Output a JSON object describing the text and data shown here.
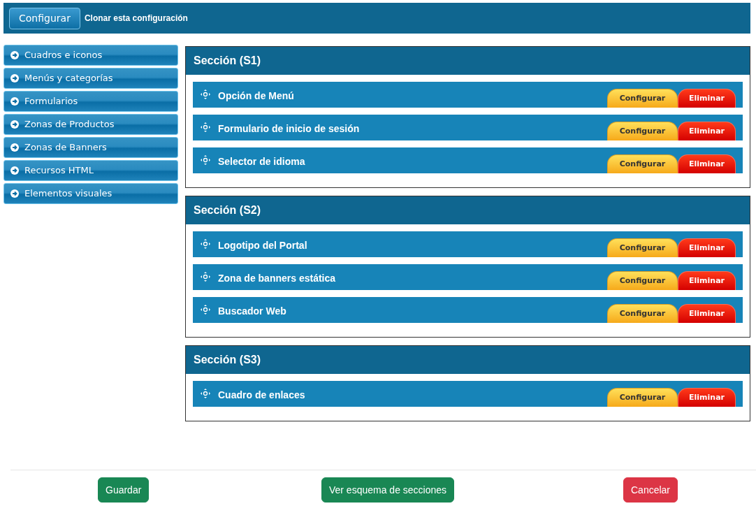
{
  "toolbar": {
    "button": "Configurar",
    "link": "Clonar esta configuración"
  },
  "sidebar": {
    "items": [
      {
        "label": "Cuadros e iconos"
      },
      {
        "label": "Menús y categorías"
      },
      {
        "label": "Formularios"
      },
      {
        "label": "Zonas de Productos"
      },
      {
        "label": "Zonas de Banners"
      },
      {
        "label": "Recursos HTML"
      },
      {
        "label": "Elementos visuales"
      }
    ]
  },
  "sections": [
    {
      "title": "Sección (S1)",
      "modules": [
        {
          "name": "Opción de Menú",
          "configure": "Configurar",
          "delete": "Eliminar"
        },
        {
          "name": "Formulario de inicio de sesión",
          "configure": "Configurar",
          "delete": "Eliminar"
        },
        {
          "name": "Selector de idioma",
          "configure": "Configurar",
          "delete": "Eliminar"
        }
      ]
    },
    {
      "title": "Sección (S2)",
      "modules": [
        {
          "name": "Logotipo del Portal",
          "configure": "Configurar",
          "delete": "Eliminar"
        },
        {
          "name": "Zona de banners estática",
          "configure": "Configurar",
          "delete": "Eliminar"
        },
        {
          "name": "Buscador Web",
          "configure": "Configurar",
          "delete": "Eliminar"
        }
      ]
    },
    {
      "title": "Sección (S3)",
      "modules": [
        {
          "name": "Cuadro de enlaces",
          "configure": "Configurar",
          "delete": "Eliminar"
        }
      ]
    }
  ],
  "footer": {
    "buttons": [
      {
        "label": "Guardar",
        "kind": "success"
      },
      {
        "label": "Ver esquema de secciones",
        "kind": "success"
      },
      {
        "label": "Cancelar",
        "kind": "danger"
      }
    ]
  }
}
